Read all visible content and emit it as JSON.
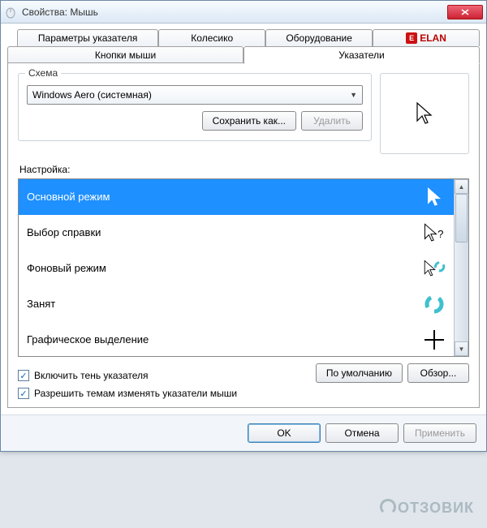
{
  "title": "Свойства: Мышь",
  "tabs": {
    "row1": [
      {
        "label": "Параметры указателя"
      },
      {
        "label": "Колесико"
      },
      {
        "label": "Оборудование"
      },
      {
        "label": "ELAN"
      }
    ],
    "row2": [
      {
        "label": "Кнопки мыши"
      },
      {
        "label": "Указатели"
      }
    ]
  },
  "scheme": {
    "legend": "Схема",
    "selected": "Windows Aero (системная)",
    "saveAs": "Сохранить как...",
    "delete": "Удалить"
  },
  "listLabel": "Настройка:",
  "items": [
    {
      "label": "Основной режим"
    },
    {
      "label": "Выбор справки"
    },
    {
      "label": "Фоновый режим"
    },
    {
      "label": "Занят"
    },
    {
      "label": "Графическое выделение"
    }
  ],
  "checks": {
    "shadow": "Включить тень указателя",
    "themes": "Разрешить темам изменять указатели мыши"
  },
  "buttons": {
    "defaults": "По умолчанию",
    "browse": "Обзор...",
    "ok": "OK",
    "cancel": "Отмена",
    "apply": "Применить"
  },
  "watermark": "ОТЗОВИК"
}
